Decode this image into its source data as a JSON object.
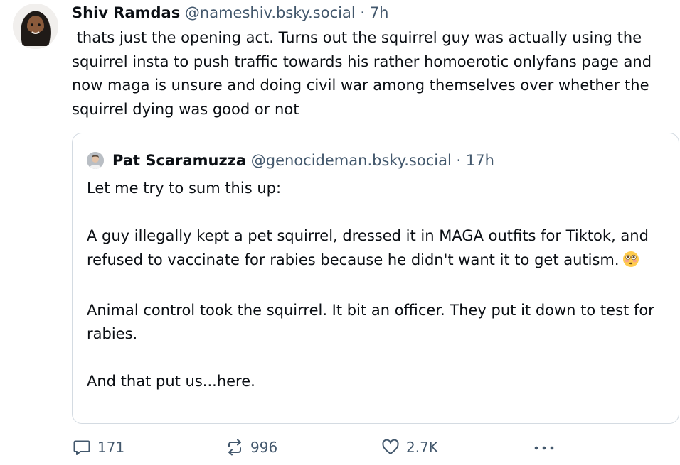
{
  "post": {
    "author_name": "Shiv Ramdas",
    "handle": "@nameshiv.bsky.social",
    "separator": "·",
    "time": "7h",
    "text": " thats just the opening act. Turns out the squirrel guy was actually using the squirrel insta to push traffic towards his rather homoerotic onlyfans page and now maga is unsure and doing civil war among themselves over whether the squirrel dying was good or not"
  },
  "quote": {
    "author_name": "Pat Scaramuzza",
    "handle": "@genocideman.bsky.social",
    "separator": "·",
    "time": "17h",
    "paragraphs": [
      "Let me try to sum this up:",
      "A guy illegally kept a pet squirrel, dressed it in MAGA outfits for Tiktok, and refused to vaccinate for rabies because he didn't want it to get autism.",
      "Animal control took the squirrel. It bit an officer. They put it down to test for rabies.",
      "And that put us...here."
    ],
    "emoji": "flushed-face-emoji"
  },
  "actions": {
    "reply_count": "171",
    "repost_count": "996",
    "like_count": "2.7K",
    "reply_icon": "speech-bubble-icon",
    "repost_icon": "repost-arrows-icon",
    "like_icon": "heart-icon",
    "more_icon": "more-dots-icon"
  },
  "colors": {
    "text": "#0b0f14",
    "muted": "#42576c",
    "border": "#d4dbe2"
  }
}
